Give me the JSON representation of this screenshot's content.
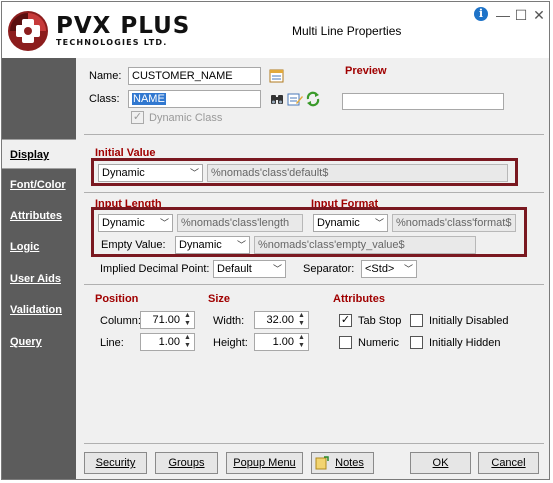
{
  "window": {
    "brand": "PVX PLUS",
    "brand_sub": "TECHNOLOGIES LTD.",
    "title": "Multi Line Properties",
    "info_glyph": "i",
    "minimize_glyph": "—",
    "maximize_glyph": "☐",
    "close_glyph": "✕"
  },
  "sidebar": {
    "items": [
      {
        "label": "Display",
        "active": true
      },
      {
        "label": "Font/Color"
      },
      {
        "label": "Attributes"
      },
      {
        "label": "Logic"
      },
      {
        "label": "User Aids"
      },
      {
        "label": "Validation"
      },
      {
        "label": "Query"
      }
    ]
  },
  "header": {
    "name_label": "Name:",
    "name_value": "CUSTOMER_NAME",
    "class_label": "Class:",
    "class_value": "NAME",
    "dynamic_class_label": "Dynamic Class",
    "dynamic_class_checked": true,
    "preview_label": "Preview",
    "preview_value": ""
  },
  "initial_value": {
    "heading": "Initial Value",
    "mode": "Dynamic",
    "expr": "%nomads'class'default$"
  },
  "input_length": {
    "heading": "Input Length",
    "mode": "Dynamic",
    "expr": "%nomads'class'length"
  },
  "input_format": {
    "heading": "Input Format",
    "mode": "Dynamic",
    "expr": "%nomads'class'format$"
  },
  "empty_value": {
    "label": "Empty Value:",
    "mode": "Dynamic",
    "expr": "%nomads'class'empty_value$"
  },
  "implied": {
    "label": "Implied Decimal Point:",
    "value": "Default",
    "separator_label": "Separator:",
    "separator_value": "<Std>"
  },
  "position": {
    "heading": "Position",
    "column_label": "Column:",
    "column_value": "71.00",
    "line_label": "Line:",
    "line_value": "1.00"
  },
  "size": {
    "heading": "Size",
    "width_label": "Width:",
    "width_value": "32.00",
    "height_label": "Height:",
    "height_value": "1.00"
  },
  "attributes": {
    "heading": "Attributes",
    "tab_stop": "Tab Stop",
    "tab_stop_checked": true,
    "numeric": "Numeric",
    "numeric_checked": false,
    "initially_disabled": "Initially Disabled",
    "initially_disabled_checked": false,
    "initially_hidden": "Initially Hidden",
    "initially_hidden_checked": false
  },
  "buttons": {
    "security": "Security",
    "groups": "Groups",
    "popup_menu": "Popup Menu",
    "notes": "Notes",
    "ok": "OK",
    "cancel": "Cancel"
  },
  "colors": {
    "sidebar_bg": "#5c5c5c",
    "section_heading": "#a00000",
    "highlight_box": "#7a1820",
    "selection": "#3178d0"
  }
}
